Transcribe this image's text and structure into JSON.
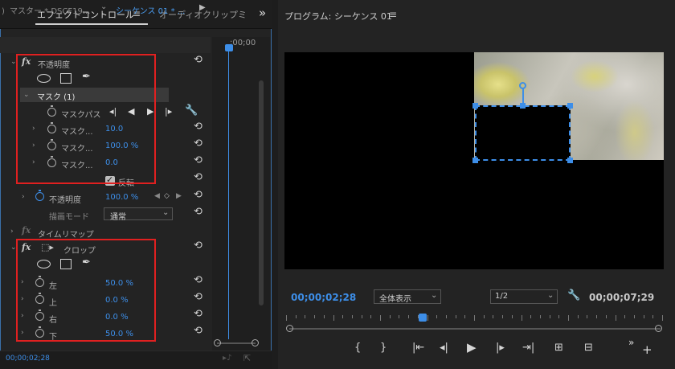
{
  "effect_panel": {
    "tab_effect": "エフェクトコントロール",
    "tab_audio": "オーディオクリップミ",
    "source_master": "マスター * DSCF19...",
    "source_sequence": "シーケンス 01 * ...",
    "opacity_label": "不透明度",
    "mask_title": "マスク (1)",
    "mask_path_label": "マスクパス",
    "mask_feather_label": "マスク...",
    "mask_feather_value": "10.0",
    "mask_opacity_label": "マスク...",
    "mask_opacity_value": "100.0 %",
    "mask_expansion_label": "マスク...",
    "mask_expansion_value": "0.0",
    "invert_label": "反転",
    "opacity_value_label": "不透明度",
    "opacity_value": "100.0 %",
    "blend_label": "描画モード",
    "blend_value": "通常",
    "time_remap_label": "タイムリマップ",
    "crop_label": "クロップ",
    "crop_left_label": "左",
    "crop_left_value": "50.0 %",
    "crop_top_label": "上",
    "crop_top_value": "0.0 %",
    "crop_right_label": "右",
    "crop_right_value": "0.0 %",
    "crop_bottom_label": "下",
    "crop_bottom_value": "50.0 %",
    "mini_timeline_time": ";00;00",
    "bottom_time": "00;00;02;28"
  },
  "program_panel": {
    "title": "プログラム: シーケンス 01",
    "current_time": "00;00;02;28",
    "zoom_value": "全体表示",
    "resolution_value": "1/2",
    "duration": "00;00;07;29",
    "playhead_fraction": 0.37
  },
  "icons": {
    "menu": "≡",
    "reset": "⟲",
    "expand": "›",
    "collapse": "⌄",
    "fx": "fx"
  },
  "colors": {
    "accent_blue": "#3d8ee8",
    "highlight_red": "#e02020"
  }
}
